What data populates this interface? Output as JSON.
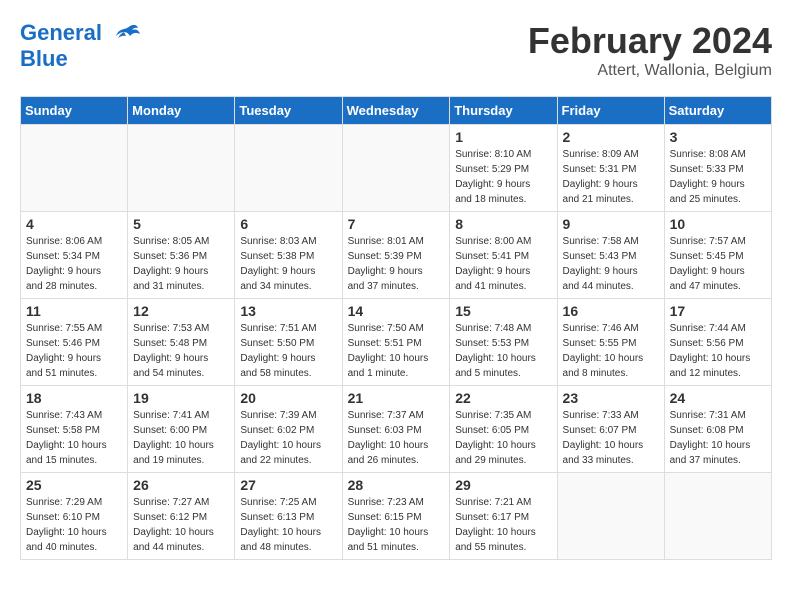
{
  "header": {
    "logo_line1": "General",
    "logo_line2": "Blue",
    "title": "February 2024",
    "location": "Attert, Wallonia, Belgium"
  },
  "days_of_week": [
    "Sunday",
    "Monday",
    "Tuesday",
    "Wednesday",
    "Thursday",
    "Friday",
    "Saturday"
  ],
  "weeks": [
    [
      {
        "day": "",
        "info": ""
      },
      {
        "day": "",
        "info": ""
      },
      {
        "day": "",
        "info": ""
      },
      {
        "day": "",
        "info": ""
      },
      {
        "day": "1",
        "info": "Sunrise: 8:10 AM\nSunset: 5:29 PM\nDaylight: 9 hours\nand 18 minutes."
      },
      {
        "day": "2",
        "info": "Sunrise: 8:09 AM\nSunset: 5:31 PM\nDaylight: 9 hours\nand 21 minutes."
      },
      {
        "day": "3",
        "info": "Sunrise: 8:08 AM\nSunset: 5:33 PM\nDaylight: 9 hours\nand 25 minutes."
      }
    ],
    [
      {
        "day": "4",
        "info": "Sunrise: 8:06 AM\nSunset: 5:34 PM\nDaylight: 9 hours\nand 28 minutes."
      },
      {
        "day": "5",
        "info": "Sunrise: 8:05 AM\nSunset: 5:36 PM\nDaylight: 9 hours\nand 31 minutes."
      },
      {
        "day": "6",
        "info": "Sunrise: 8:03 AM\nSunset: 5:38 PM\nDaylight: 9 hours\nand 34 minutes."
      },
      {
        "day": "7",
        "info": "Sunrise: 8:01 AM\nSunset: 5:39 PM\nDaylight: 9 hours\nand 37 minutes."
      },
      {
        "day": "8",
        "info": "Sunrise: 8:00 AM\nSunset: 5:41 PM\nDaylight: 9 hours\nand 41 minutes."
      },
      {
        "day": "9",
        "info": "Sunrise: 7:58 AM\nSunset: 5:43 PM\nDaylight: 9 hours\nand 44 minutes."
      },
      {
        "day": "10",
        "info": "Sunrise: 7:57 AM\nSunset: 5:45 PM\nDaylight: 9 hours\nand 47 minutes."
      }
    ],
    [
      {
        "day": "11",
        "info": "Sunrise: 7:55 AM\nSunset: 5:46 PM\nDaylight: 9 hours\nand 51 minutes."
      },
      {
        "day": "12",
        "info": "Sunrise: 7:53 AM\nSunset: 5:48 PM\nDaylight: 9 hours\nand 54 minutes."
      },
      {
        "day": "13",
        "info": "Sunrise: 7:51 AM\nSunset: 5:50 PM\nDaylight: 9 hours\nand 58 minutes."
      },
      {
        "day": "14",
        "info": "Sunrise: 7:50 AM\nSunset: 5:51 PM\nDaylight: 10 hours\nand 1 minute."
      },
      {
        "day": "15",
        "info": "Sunrise: 7:48 AM\nSunset: 5:53 PM\nDaylight: 10 hours\nand 5 minutes."
      },
      {
        "day": "16",
        "info": "Sunrise: 7:46 AM\nSunset: 5:55 PM\nDaylight: 10 hours\nand 8 minutes."
      },
      {
        "day": "17",
        "info": "Sunrise: 7:44 AM\nSunset: 5:56 PM\nDaylight: 10 hours\nand 12 minutes."
      }
    ],
    [
      {
        "day": "18",
        "info": "Sunrise: 7:43 AM\nSunset: 5:58 PM\nDaylight: 10 hours\nand 15 minutes."
      },
      {
        "day": "19",
        "info": "Sunrise: 7:41 AM\nSunset: 6:00 PM\nDaylight: 10 hours\nand 19 minutes."
      },
      {
        "day": "20",
        "info": "Sunrise: 7:39 AM\nSunset: 6:02 PM\nDaylight: 10 hours\nand 22 minutes."
      },
      {
        "day": "21",
        "info": "Sunrise: 7:37 AM\nSunset: 6:03 PM\nDaylight: 10 hours\nand 26 minutes."
      },
      {
        "day": "22",
        "info": "Sunrise: 7:35 AM\nSunset: 6:05 PM\nDaylight: 10 hours\nand 29 minutes."
      },
      {
        "day": "23",
        "info": "Sunrise: 7:33 AM\nSunset: 6:07 PM\nDaylight: 10 hours\nand 33 minutes."
      },
      {
        "day": "24",
        "info": "Sunrise: 7:31 AM\nSunset: 6:08 PM\nDaylight: 10 hours\nand 37 minutes."
      }
    ],
    [
      {
        "day": "25",
        "info": "Sunrise: 7:29 AM\nSunset: 6:10 PM\nDaylight: 10 hours\nand 40 minutes."
      },
      {
        "day": "26",
        "info": "Sunrise: 7:27 AM\nSunset: 6:12 PM\nDaylight: 10 hours\nand 44 minutes."
      },
      {
        "day": "27",
        "info": "Sunrise: 7:25 AM\nSunset: 6:13 PM\nDaylight: 10 hours\nand 48 minutes."
      },
      {
        "day": "28",
        "info": "Sunrise: 7:23 AM\nSunset: 6:15 PM\nDaylight: 10 hours\nand 51 minutes."
      },
      {
        "day": "29",
        "info": "Sunrise: 7:21 AM\nSunset: 6:17 PM\nDaylight: 10 hours\nand 55 minutes."
      },
      {
        "day": "",
        "info": ""
      },
      {
        "day": "",
        "info": ""
      }
    ]
  ]
}
